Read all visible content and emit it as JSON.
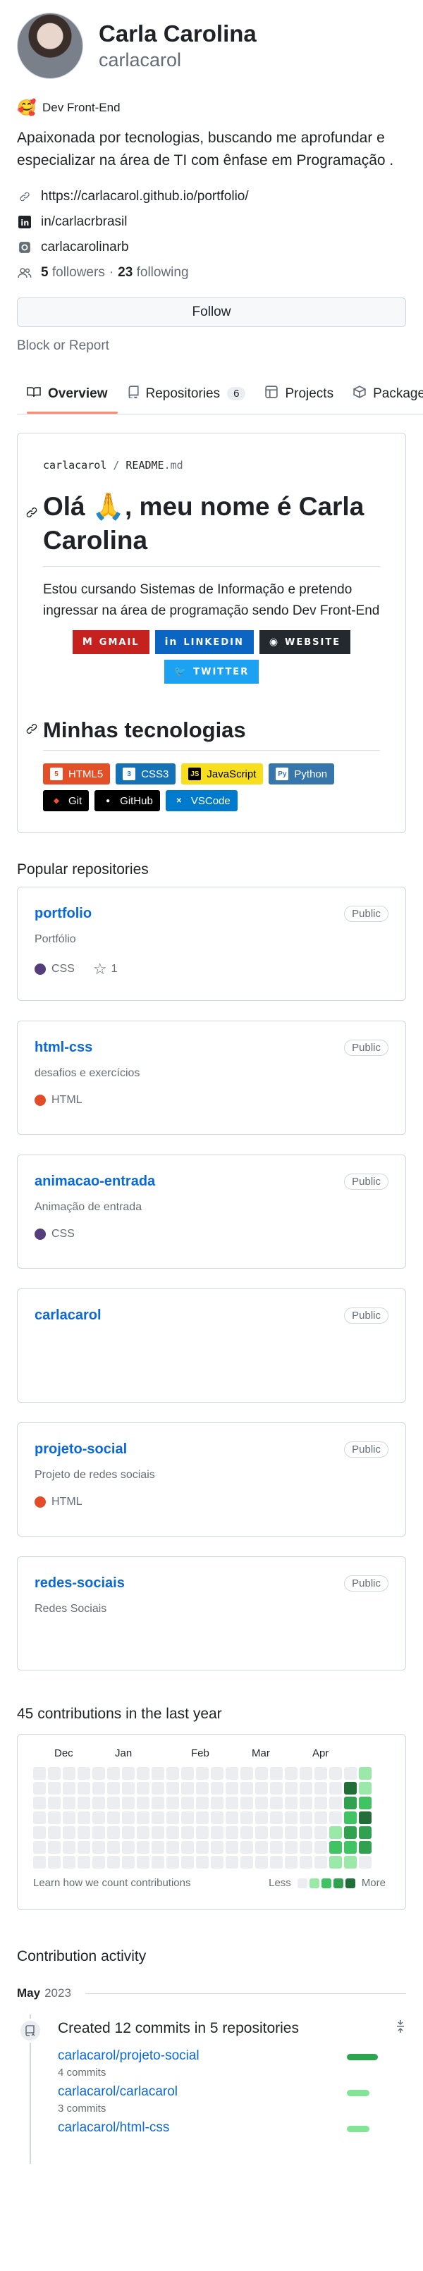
{
  "profile": {
    "name": "Carla Carolina",
    "login": "carlacarol",
    "status_emoji": "🥰",
    "status_text": "Dev Front-End",
    "bio": "Apaixonada por tecnologias, buscando me aprofundar e especializar na área de TI com ênfase em Programação .",
    "website": "https://carlacarol.github.io/portfolio/",
    "linkedin": "in/carlacrbrasil",
    "instagram": "carlacarolinarb",
    "followers_count": "5",
    "followers_label": "followers",
    "dot": "·",
    "following_count": "23",
    "following_label": "following",
    "follow_label": "Follow",
    "block_report": "Block or Report"
  },
  "tabs": [
    {
      "label": "Overview",
      "icon": "book-icon"
    },
    {
      "label": "Repositories",
      "icon": "repo-icon",
      "counter": "6"
    },
    {
      "label": "Projects",
      "icon": "table-icon"
    },
    {
      "label": "Packages",
      "icon": "package-icon"
    }
  ],
  "readme": {
    "path_user": "carlacarol",
    "path_sep": "/",
    "path_file": "README",
    "path_ext": ".md",
    "heading": "Olá 🙏, meu nome é Carla Carolina",
    "paragraph": "Estou cursando Sistemas de Informação e pretendo ingressar na área de programação sendo Dev Front-End",
    "badges": [
      {
        "label": "GMAIL",
        "icon": "M",
        "color": "#c5221f"
      },
      {
        "label": "LINKEDIN",
        "icon": "in",
        "color": "#0a66c2"
      },
      {
        "label": "WEBSITE",
        "icon": "◉",
        "color": "#24292f"
      },
      {
        "label": "TWITTER",
        "icon": "🐦",
        "color": "#1da1f2"
      }
    ],
    "tech_heading": "Minhas tecnologias",
    "techs": [
      {
        "label": "HTML5",
        "icon": "5",
        "bg": "#e34f26",
        "fg": "#ffffff"
      },
      {
        "label": "CSS3",
        "icon": "3",
        "bg": "#1572b6",
        "fg": "#ffffff"
      },
      {
        "label": "JavaScript",
        "icon": "JS",
        "bg": "#f7df1e",
        "fg": "#000000"
      },
      {
        "label": "Python",
        "icon": "Py",
        "bg": "#3776ab",
        "fg": "#ffffff"
      },
      {
        "label": "Git",
        "icon": "◆",
        "bg": "#000000",
        "fg": "#ffffff"
      },
      {
        "label": "GitHub",
        "icon": "●",
        "bg": "#000000",
        "fg": "#ffffff"
      },
      {
        "label": "VSCode",
        "icon": "✕",
        "bg": "#007acc",
        "fg": "#ffffff"
      }
    ]
  },
  "popular": {
    "title": "Popular repositories",
    "repos": [
      {
        "name": "portfolio",
        "visibility": "Public",
        "desc": "Portfólio",
        "lang": "CSS",
        "lang_color": "#563d7c",
        "stars": "1"
      },
      {
        "name": "html-css",
        "visibility": "Public",
        "desc": "desafios e exercícios",
        "lang": "HTML",
        "lang_color": "#e34c26",
        "stars": ""
      },
      {
        "name": "animacao-entrada",
        "visibility": "Public",
        "desc": "Animação de entrada",
        "lang": "CSS",
        "lang_color": "#563d7c",
        "stars": ""
      },
      {
        "name": "carlacarol",
        "visibility": "Public",
        "desc": "",
        "lang": "",
        "lang_color": "",
        "stars": ""
      },
      {
        "name": "projeto-social",
        "visibility": "Public",
        "desc": "Projeto de redes sociais",
        "lang": "HTML",
        "lang_color": "#e34c26",
        "stars": ""
      },
      {
        "name": "redes-sociais",
        "visibility": "Public",
        "desc": "Redes Sociais",
        "lang": "",
        "lang_color": "",
        "stars": ""
      }
    ]
  },
  "contributions": {
    "title": "45 contributions in the last year",
    "months": [
      "Dec",
      "Jan",
      "Feb",
      "Mar",
      "Apr"
    ],
    "learn": "Learn how we count contributions",
    "less": "Less",
    "more": "More",
    "palette": [
      "#ebedf0",
      "#9be9a8",
      "#40c463",
      "#30a14e",
      "#216e39"
    ],
    "levels": [
      [
        0,
        0,
        0,
        0,
        0,
        0,
        0
      ],
      [
        0,
        0,
        0,
        0,
        0,
        0,
        0
      ],
      [
        0,
        0,
        0,
        0,
        0,
        0,
        0
      ],
      [
        0,
        0,
        0,
        0,
        0,
        0,
        0
      ],
      [
        0,
        0,
        0,
        0,
        0,
        0,
        0
      ],
      [
        0,
        0,
        0,
        0,
        0,
        0,
        0
      ],
      [
        0,
        0,
        0,
        0,
        0,
        0,
        0
      ],
      [
        0,
        0,
        0,
        0,
        0,
        0,
        0
      ],
      [
        0,
        0,
        0,
        0,
        0,
        0,
        0
      ],
      [
        0,
        0,
        0,
        0,
        0,
        0,
        0
      ],
      [
        0,
        0,
        0,
        0,
        0,
        0,
        0
      ],
      [
        0,
        0,
        0,
        0,
        0,
        0,
        0
      ],
      [
        0,
        0,
        0,
        0,
        0,
        0,
        0
      ],
      [
        0,
        0,
        0,
        0,
        0,
        0,
        0
      ],
      [
        0,
        0,
        0,
        0,
        0,
        0,
        0
      ],
      [
        0,
        0,
        0,
        0,
        0,
        0,
        0
      ],
      [
        0,
        0,
        0,
        0,
        0,
        0,
        0
      ],
      [
        0,
        0,
        0,
        0,
        0,
        0,
        0
      ],
      [
        0,
        0,
        0,
        0,
        0,
        0,
        0
      ],
      [
        0,
        0,
        0,
        0,
        0,
        0,
        0
      ],
      [
        0,
        0,
        0,
        0,
        1,
        2,
        1
      ],
      [
        0,
        4,
        3,
        2,
        3,
        2,
        1
      ],
      [
        1,
        1,
        2,
        4,
        3,
        3,
        0
      ]
    ]
  },
  "activity": {
    "title": "Contribution activity",
    "month": "May",
    "year": "2023",
    "event_title": "Created 12 commits in 5 repositories",
    "commits": [
      {
        "repo": "carlacarol/projeto-social",
        "count": "4 commits",
        "color": "#2da44e"
      },
      {
        "repo": "carlacarol/carlacarol",
        "count": "3 commits",
        "color": "#82e596"
      },
      {
        "repo": "carlacarol/html-css",
        "count": "",
        "color": "#82e596"
      }
    ]
  }
}
